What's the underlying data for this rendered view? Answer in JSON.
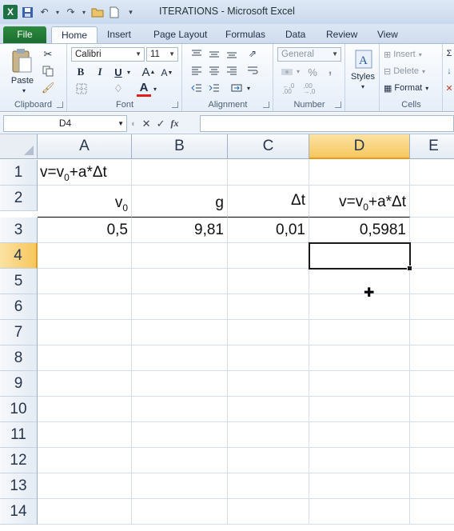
{
  "window": {
    "title": "ITERATIONS  -  Microsoft Excel",
    "qat_icons": [
      "excel-logo-icon",
      "save-icon",
      "undo-icon",
      "redo-icon",
      "open-icon",
      "new-icon",
      "customize-qat-icon"
    ]
  },
  "tabs": [
    "File",
    "Home",
    "Insert",
    "Page Layout",
    "Formulas",
    "Data",
    "Review",
    "View"
  ],
  "ribbon": {
    "clipboard": {
      "label": "Clipboard",
      "paste": "Paste"
    },
    "font": {
      "label": "Font",
      "name": "Calibri",
      "size": "11",
      "bold": "B",
      "italic": "I",
      "underline": "U",
      "font_color": "A"
    },
    "alignment": {
      "label": "Alignment"
    },
    "number": {
      "label": "Number",
      "format": "General",
      "percent": "%",
      "comma": ",",
      "inc_dec": "°,0 .00",
      "dec_dec": ",00 →,0"
    },
    "styles": {
      "label": "Styles"
    },
    "cells": {
      "label": "Cells",
      "insert": "Insert",
      "delete": "Delete",
      "format": "Format"
    }
  },
  "formula_bar": {
    "name_box": "D4",
    "fx": "fx",
    "formula": ""
  },
  "columns": [
    "A",
    "B",
    "C",
    "D",
    "E"
  ],
  "selected_column": "D",
  "rows": [
    "1",
    "2",
    "3",
    "4",
    "5",
    "6",
    "7",
    "8",
    "9",
    "10",
    "11",
    "12",
    "13",
    "14"
  ],
  "selected_row": "4",
  "cells": {
    "A1": {
      "pre": "v=v",
      "sub": "0",
      "post": "+a*Δt"
    },
    "A2": {
      "pre": "v",
      "sub": "0",
      "post": ""
    },
    "B2": "g",
    "C2": "Δt",
    "D2": {
      "pre": "v=v",
      "sub": "0",
      "post": "+a*Δt"
    },
    "A3": "0,5",
    "B3": "9,81",
    "C3": "0,01",
    "D3": "0,5981"
  },
  "colors": {
    "file_tab": "#2c8a3e",
    "selected_header": "#f7c75c",
    "excel_green": "#1e7145"
  }
}
